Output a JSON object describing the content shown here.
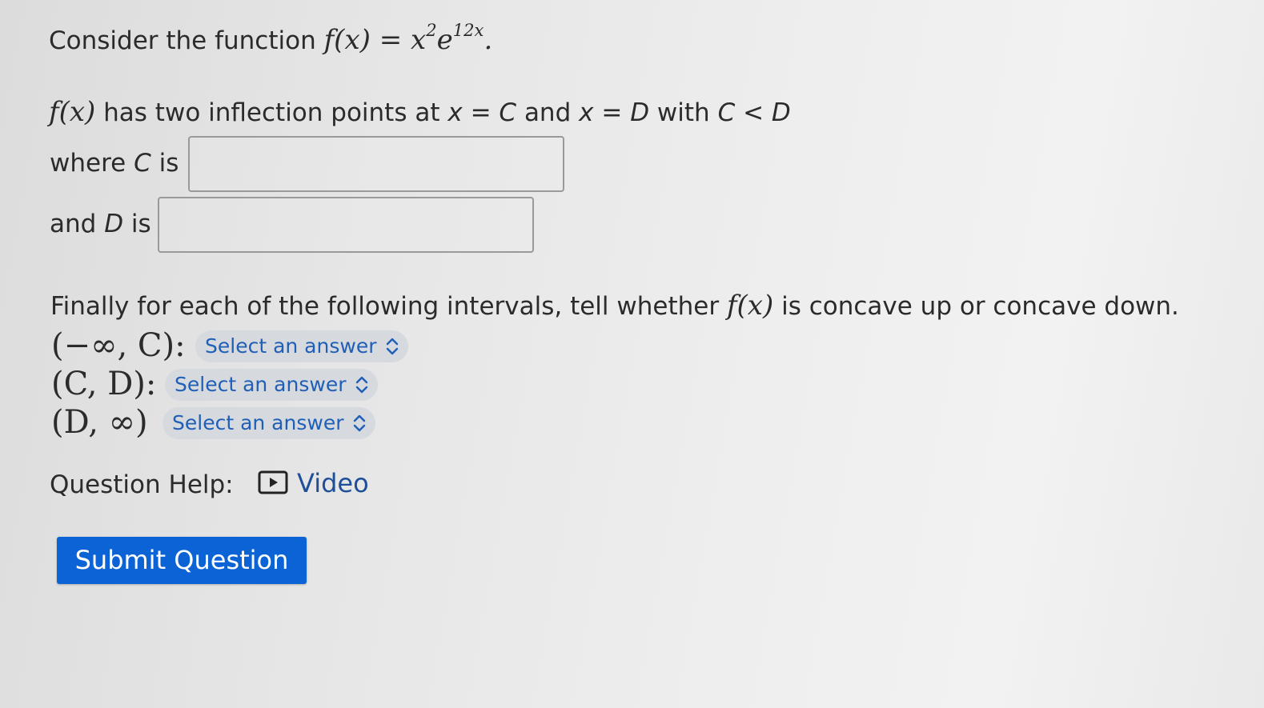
{
  "question": {
    "intro_text": "Consider the function",
    "function_lhs": "f(x) =",
    "function_base": "x",
    "function_exp1": "2",
    "function_e": "e",
    "function_exp2": "12x",
    "function_end": ".",
    "inflection_fx": "f(x)",
    "inflection_text": "has two inflection points at",
    "inflection_x1": "x",
    "inflection_eq1": "=",
    "inflection_C": "C",
    "inflection_and": "and",
    "inflection_x2": "x",
    "inflection_eq2": "=",
    "inflection_D": "D",
    "inflection_with": "with",
    "inflection_C2": "C",
    "inflection_lt": "<",
    "inflection_D2": "D"
  },
  "fields": {
    "c_label_pre": "where",
    "c_label_var": "C",
    "c_label_post": "is",
    "c_value": "",
    "d_label_pre": "and",
    "d_label_var": "D",
    "d_label_post": "is",
    "d_value": ""
  },
  "concavity": {
    "prompt_pre": "Finally for each of the following intervals, tell whether",
    "prompt_fx": "f(x)",
    "prompt_post": "is concave up or concave down.",
    "intervals": [
      {
        "label": "(−∞, C):",
        "selected": "Select an answer"
      },
      {
        "label": "(C, D):",
        "selected": "Select an answer"
      },
      {
        "label": "(D, ∞)",
        "selected": "Select an answer"
      }
    ]
  },
  "help": {
    "label": "Question Help:",
    "video_label": "Video",
    "video_icon": "play-icon"
  },
  "submit": {
    "label": "Submit Question",
    "color": "#0b63d6"
  },
  "colors": {
    "link": "#1f5fb8",
    "select_bg": "#d6d9dd"
  }
}
